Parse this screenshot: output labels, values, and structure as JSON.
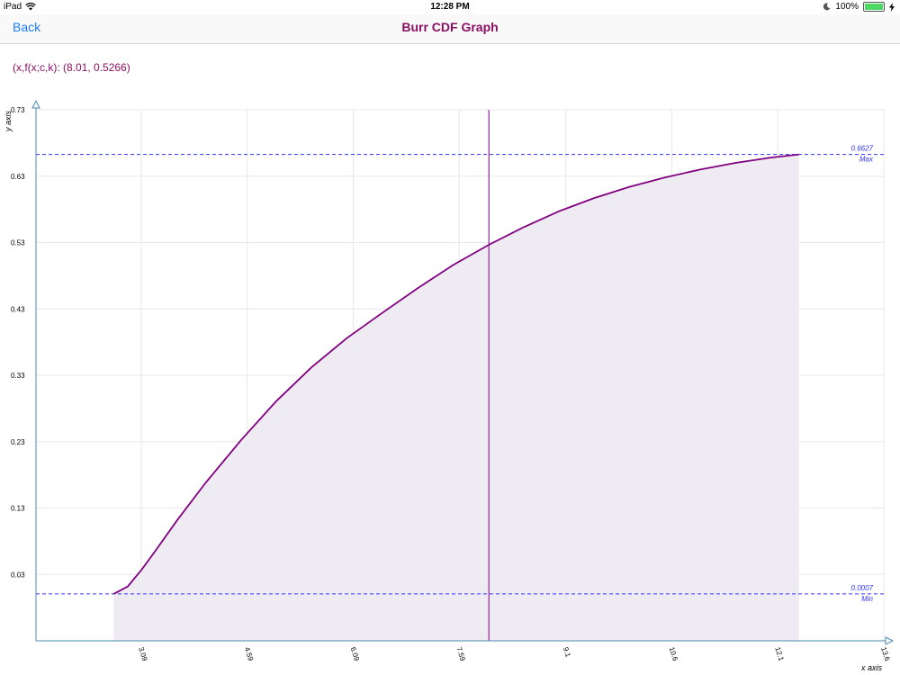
{
  "status": {
    "device": "iPad",
    "time": "12:28 PM",
    "battery": "100%",
    "battery_level": 1.0
  },
  "nav": {
    "back_label": "Back",
    "title": "Burr CDF Graph"
  },
  "readout": "(x,f(x;c,k): (8.01, 0.5266)",
  "colors": {
    "curve": "#800080",
    "fill": "#efebf3",
    "dashed": "#3333ff",
    "title": "#8b1062",
    "link": "#1a7ef7"
  },
  "chart_data": {
    "type": "area",
    "title": "",
    "xlabel": "x axis",
    "ylabel": "y axis",
    "xlim": [
      1.6,
      13.6
    ],
    "ylim": [
      -0.07,
      0.73
    ],
    "x_ticks": [
      "3.09",
      "4.59",
      "6.09",
      "7.59",
      "9.1",
      "10.6",
      "12.1",
      "13.6"
    ],
    "x_tick_values": [
      3.09,
      4.59,
      6.09,
      7.59,
      9.1,
      10.6,
      12.1,
      13.6
    ],
    "y_ticks": [
      "0.73",
      "0.63",
      "0.53",
      "0.43",
      "0.33",
      "0.23",
      "0.13",
      "0.03"
    ],
    "y_tick_values": [
      0.73,
      0.63,
      0.53,
      0.43,
      0.33,
      0.23,
      0.13,
      0.03
    ],
    "grid": true,
    "series": [
      {
        "x": [
          2.7,
          2.9,
          3.1,
          3.3,
          3.6,
          4.0,
          4.5,
          5.0,
          5.5,
          6.0,
          6.5,
          7.0,
          7.5,
          8.01,
          8.5,
          9.0,
          9.5,
          10.0,
          10.5,
          11.0,
          11.5,
          12.0,
          12.4
        ],
        "y": [
          0.0007,
          0.012,
          0.038,
          0.067,
          0.112,
          0.168,
          0.232,
          0.291,
          0.342,
          0.386,
          0.424,
          0.461,
          0.496,
          0.5266,
          0.553,
          0.577,
          0.597,
          0.614,
          0.628,
          0.64,
          0.65,
          0.658,
          0.6627
        ]
      }
    ],
    "cursor": {
      "x": 8.01,
      "y": 0.5266
    },
    "max": {
      "value": 0.6627,
      "value_label": "0.6627",
      "label": "Max"
    },
    "min": {
      "value": 0.0007,
      "value_label": "0.0007",
      "label": "Min"
    }
  }
}
